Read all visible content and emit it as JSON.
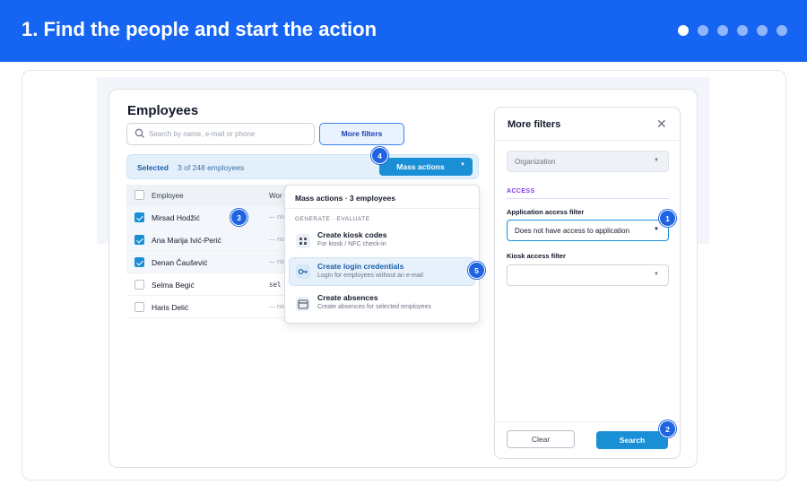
{
  "banner": {
    "title": "1. Find the people and start the action",
    "steps": [
      true,
      false,
      false,
      false,
      false,
      false
    ]
  },
  "app": {
    "title": "Employees",
    "search_placeholder": "Search by name, e-mail or phone",
    "more_filters_label": "More filters",
    "selection": {
      "label": "Selected",
      "count": "3 of 248 employees"
    },
    "mass_actions_label": "Mass actions"
  },
  "table": {
    "headers": {
      "employee": "Employee",
      "work": "Wor"
    },
    "rows": [
      {
        "name": "Mirsad Hodžić",
        "checked": true,
        "value": "— no"
      },
      {
        "name": "Ana Marija Ivić-Perić",
        "checked": true,
        "value": "— no"
      },
      {
        "name": "Denan Čaušević",
        "checked": true,
        "value": "— no"
      },
      {
        "name": "Selma Begić",
        "checked": false,
        "value": "sel"
      },
      {
        "name": "Haris Delić",
        "checked": false,
        "value": "— no"
      }
    ]
  },
  "menu": {
    "title": "Mass actions · 3 employees",
    "group": "GENERATE · EVALUATE",
    "items": [
      {
        "title": "Create kiosk codes",
        "subtitle": "For kiosk / NFC check-in",
        "icon": "grid-icon"
      },
      {
        "title": "Create login credentials",
        "subtitle": "Login for employees without an e-mail",
        "icon": "key-icon"
      },
      {
        "title": "Create absences",
        "subtitle": "Create absences for selected employees",
        "icon": "calendar-icon"
      }
    ]
  },
  "panel": {
    "title": "More filters",
    "organization": "Organization",
    "section": "ACCESS",
    "app_access_label": "Application access filter",
    "app_access_value": "Does not have access to application",
    "kiosk_label": "Kiosk access filter",
    "kiosk_value": "",
    "clear_label": "Clear",
    "search_label": "Search"
  },
  "badges": [
    "1",
    "2",
    "3",
    "4",
    "5"
  ],
  "colors": {
    "accent": "#1665f2",
    "button": "#1a8fd6",
    "access": "#7c3aed"
  }
}
